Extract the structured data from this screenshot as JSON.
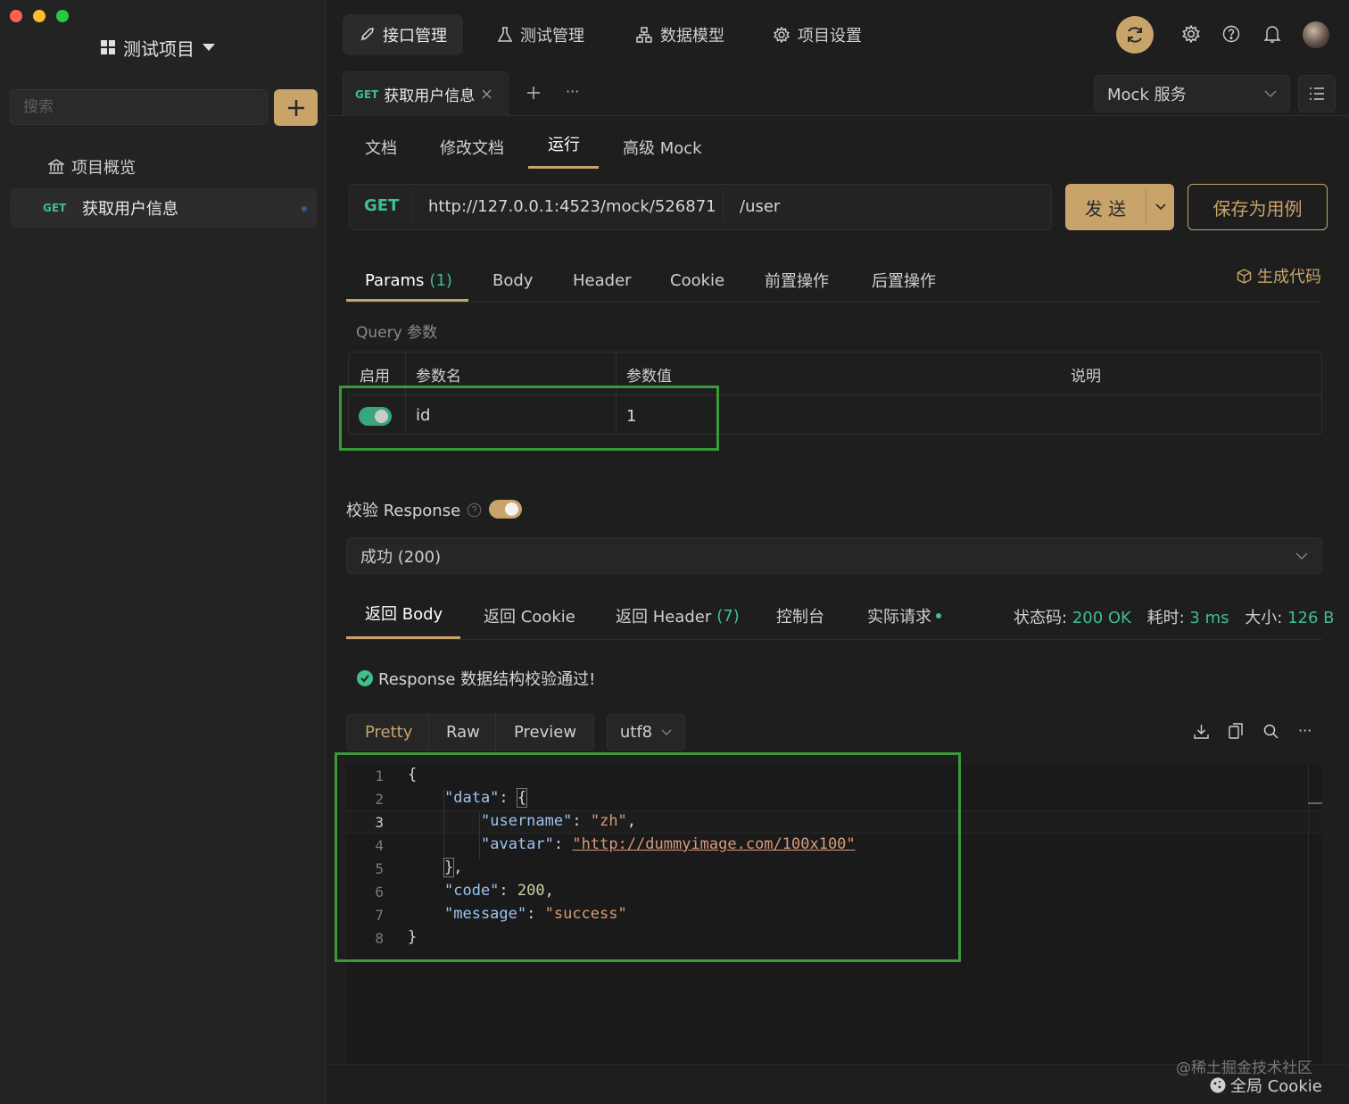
{
  "sidebar": {
    "project_title": "测试项目",
    "search_placeholder": "搜索",
    "items": [
      {
        "label": "项目概览"
      },
      {
        "method": "GET",
        "label": "获取用户信息"
      }
    ]
  },
  "topnav": {
    "tabs": [
      {
        "label": "接口管理",
        "icon": "rocket-icon"
      },
      {
        "label": "测试管理",
        "icon": "flask-icon"
      },
      {
        "label": "数据模型",
        "icon": "hierarchy-icon"
      },
      {
        "label": "项目设置",
        "icon": "gear-icon"
      }
    ]
  },
  "doc_tab": {
    "method": "GET",
    "title": "获取用户信息",
    "more": "···"
  },
  "env_select": {
    "value": "Mock 服务"
  },
  "subtabs": [
    "文档",
    "修改文档",
    "运行",
    "高级 Mock"
  ],
  "request": {
    "method": "GET",
    "base_url": "http://127.0.0.1:4523/mock/526871",
    "path": "/user",
    "send_label": "发 送",
    "save_label": "保存为用例"
  },
  "param_tabs": {
    "params_label": "Params",
    "params_count": "(1)",
    "body": "Body",
    "header": "Header",
    "cookie": "Cookie",
    "pre": "前置操作",
    "post": "后置操作",
    "gen_code": "生成代码"
  },
  "query": {
    "section_label": "Query 参数",
    "headers": [
      "启用",
      "参数名",
      "参数值",
      "说明"
    ],
    "rows": [
      {
        "enabled": true,
        "name": "id",
        "value": "1",
        "desc": ""
      }
    ]
  },
  "validate": {
    "label": "校验 Response",
    "enabled": true,
    "select_value": "成功 (200)"
  },
  "response_tabs": {
    "body": "返回 Body",
    "cookie": "返回 Cookie",
    "header_label": "返回 Header",
    "header_count": "(7)",
    "console": "控制台",
    "actual": "实际请求"
  },
  "status": {
    "code_label": "状态码:",
    "code_value": "200 OK",
    "time_label": "耗时:",
    "time_value": "3 ms",
    "size_label": "大小:",
    "size_value": "126 B"
  },
  "validation_msg": "Response 数据结构校验通过!",
  "view_tabs": {
    "pretty": "Pretty",
    "raw": "Raw",
    "preview": "Preview",
    "encoding": "utf8"
  },
  "code": {
    "line_numbers": [
      "1",
      "2",
      "3",
      "4",
      "5",
      "6",
      "7",
      "8"
    ],
    "data_key": "\"data\"",
    "username_key": "\"username\"",
    "username_val": "\"zh\"",
    "avatar_key": "\"avatar\"",
    "avatar_val": "\"http://dummyimage.com/100x100\"",
    "code_key": "\"code\"",
    "code_val": "200",
    "message_key": "\"message\"",
    "message_val": "\"success\""
  },
  "footer": {
    "watermark": "@稀土掘金技术社区",
    "global_cookie": "全局 Cookie"
  },
  "colors": {
    "accent": "#c8a46b",
    "green": "#3fbf8c",
    "highlight_box": "#3a9a3a"
  }
}
